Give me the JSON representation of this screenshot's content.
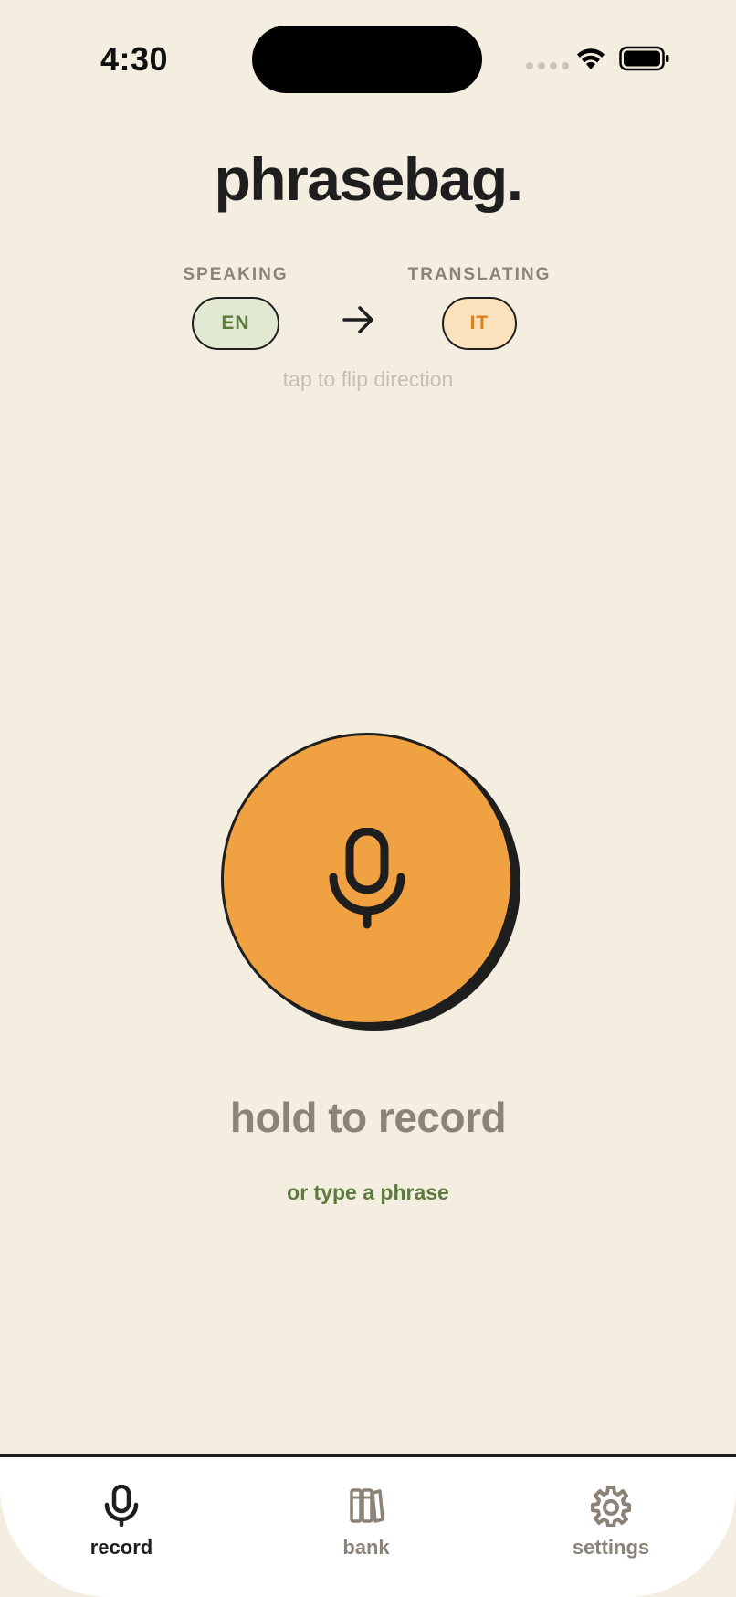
{
  "status_bar": {
    "time": "4:30"
  },
  "app": {
    "title": "phrasebag."
  },
  "languages": {
    "speaking_label": "SPEAKING",
    "translating_label": "TRANSLATING",
    "source": "EN",
    "target": "IT",
    "flip_hint": "tap to flip direction"
  },
  "record": {
    "hold_label": "hold to record",
    "type_link": "or type a phrase"
  },
  "tabs": [
    {
      "label": "record",
      "icon": "microphone-icon",
      "active": true
    },
    {
      "label": "bank",
      "icon": "books-icon",
      "active": false
    },
    {
      "label": "settings",
      "icon": "gear-icon",
      "active": false
    }
  ],
  "colors": {
    "background": "#f3eee0",
    "accent_orange": "#f0a243",
    "accent_green": "#5d7b3e",
    "muted": "#8b8377",
    "ink": "#1e1e1e"
  }
}
